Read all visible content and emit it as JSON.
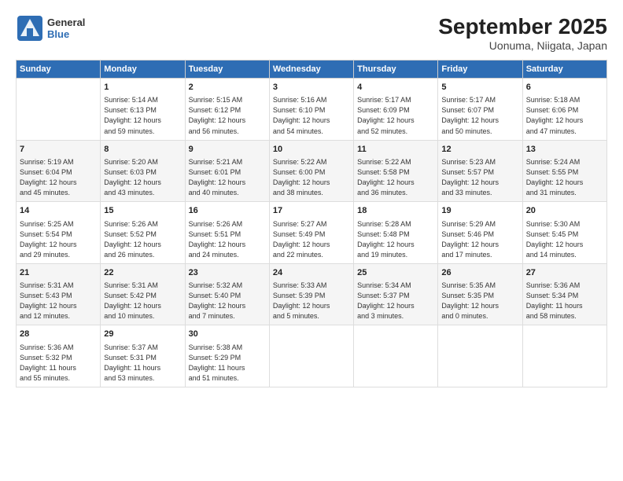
{
  "logo": {
    "general": "General",
    "blue": "Blue"
  },
  "title": "September 2025",
  "subtitle": "Uonuma, Niigata, Japan",
  "days": [
    "Sunday",
    "Monday",
    "Tuesday",
    "Wednesday",
    "Thursday",
    "Friday",
    "Saturday"
  ],
  "weeks": [
    [
      {
        "day": "",
        "info": ""
      },
      {
        "day": "1",
        "info": "Sunrise: 5:14 AM\nSunset: 6:13 PM\nDaylight: 12 hours\nand 59 minutes."
      },
      {
        "day": "2",
        "info": "Sunrise: 5:15 AM\nSunset: 6:12 PM\nDaylight: 12 hours\nand 56 minutes."
      },
      {
        "day": "3",
        "info": "Sunrise: 5:16 AM\nSunset: 6:10 PM\nDaylight: 12 hours\nand 54 minutes."
      },
      {
        "day": "4",
        "info": "Sunrise: 5:17 AM\nSunset: 6:09 PM\nDaylight: 12 hours\nand 52 minutes."
      },
      {
        "day": "5",
        "info": "Sunrise: 5:17 AM\nSunset: 6:07 PM\nDaylight: 12 hours\nand 50 minutes."
      },
      {
        "day": "6",
        "info": "Sunrise: 5:18 AM\nSunset: 6:06 PM\nDaylight: 12 hours\nand 47 minutes."
      }
    ],
    [
      {
        "day": "7",
        "info": "Sunrise: 5:19 AM\nSunset: 6:04 PM\nDaylight: 12 hours\nand 45 minutes."
      },
      {
        "day": "8",
        "info": "Sunrise: 5:20 AM\nSunset: 6:03 PM\nDaylight: 12 hours\nand 43 minutes."
      },
      {
        "day": "9",
        "info": "Sunrise: 5:21 AM\nSunset: 6:01 PM\nDaylight: 12 hours\nand 40 minutes."
      },
      {
        "day": "10",
        "info": "Sunrise: 5:22 AM\nSunset: 6:00 PM\nDaylight: 12 hours\nand 38 minutes."
      },
      {
        "day": "11",
        "info": "Sunrise: 5:22 AM\nSunset: 5:58 PM\nDaylight: 12 hours\nand 36 minutes."
      },
      {
        "day": "12",
        "info": "Sunrise: 5:23 AM\nSunset: 5:57 PM\nDaylight: 12 hours\nand 33 minutes."
      },
      {
        "day": "13",
        "info": "Sunrise: 5:24 AM\nSunset: 5:55 PM\nDaylight: 12 hours\nand 31 minutes."
      }
    ],
    [
      {
        "day": "14",
        "info": "Sunrise: 5:25 AM\nSunset: 5:54 PM\nDaylight: 12 hours\nand 29 minutes."
      },
      {
        "day": "15",
        "info": "Sunrise: 5:26 AM\nSunset: 5:52 PM\nDaylight: 12 hours\nand 26 minutes."
      },
      {
        "day": "16",
        "info": "Sunrise: 5:26 AM\nSunset: 5:51 PM\nDaylight: 12 hours\nand 24 minutes."
      },
      {
        "day": "17",
        "info": "Sunrise: 5:27 AM\nSunset: 5:49 PM\nDaylight: 12 hours\nand 22 minutes."
      },
      {
        "day": "18",
        "info": "Sunrise: 5:28 AM\nSunset: 5:48 PM\nDaylight: 12 hours\nand 19 minutes."
      },
      {
        "day": "19",
        "info": "Sunrise: 5:29 AM\nSunset: 5:46 PM\nDaylight: 12 hours\nand 17 minutes."
      },
      {
        "day": "20",
        "info": "Sunrise: 5:30 AM\nSunset: 5:45 PM\nDaylight: 12 hours\nand 14 minutes."
      }
    ],
    [
      {
        "day": "21",
        "info": "Sunrise: 5:31 AM\nSunset: 5:43 PM\nDaylight: 12 hours\nand 12 minutes."
      },
      {
        "day": "22",
        "info": "Sunrise: 5:31 AM\nSunset: 5:42 PM\nDaylight: 12 hours\nand 10 minutes."
      },
      {
        "day": "23",
        "info": "Sunrise: 5:32 AM\nSunset: 5:40 PM\nDaylight: 12 hours\nand 7 minutes."
      },
      {
        "day": "24",
        "info": "Sunrise: 5:33 AM\nSunset: 5:39 PM\nDaylight: 12 hours\nand 5 minutes."
      },
      {
        "day": "25",
        "info": "Sunrise: 5:34 AM\nSunset: 5:37 PM\nDaylight: 12 hours\nand 3 minutes."
      },
      {
        "day": "26",
        "info": "Sunrise: 5:35 AM\nSunset: 5:35 PM\nDaylight: 12 hours\nand 0 minutes."
      },
      {
        "day": "27",
        "info": "Sunrise: 5:36 AM\nSunset: 5:34 PM\nDaylight: 11 hours\nand 58 minutes."
      }
    ],
    [
      {
        "day": "28",
        "info": "Sunrise: 5:36 AM\nSunset: 5:32 PM\nDaylight: 11 hours\nand 55 minutes."
      },
      {
        "day": "29",
        "info": "Sunrise: 5:37 AM\nSunset: 5:31 PM\nDaylight: 11 hours\nand 53 minutes."
      },
      {
        "day": "30",
        "info": "Sunrise: 5:38 AM\nSunset: 5:29 PM\nDaylight: 11 hours\nand 51 minutes."
      },
      {
        "day": "",
        "info": ""
      },
      {
        "day": "",
        "info": ""
      },
      {
        "day": "",
        "info": ""
      },
      {
        "day": "",
        "info": ""
      }
    ]
  ]
}
